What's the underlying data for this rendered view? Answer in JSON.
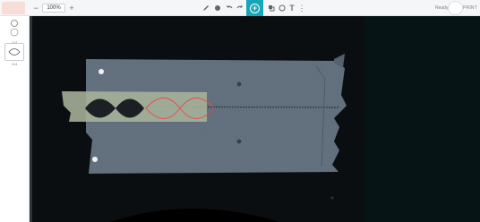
{
  "toolbar": {
    "zoom_out": "−",
    "zoom_value": "100%",
    "zoom_in": "+",
    "tools": [
      {
        "name": "draw-tool-icon",
        "glyph": "✎"
      },
      {
        "name": "fill-tool-icon",
        "glyph": "●"
      },
      {
        "name": "undo-icon",
        "glyph": "↶"
      },
      {
        "name": "redo-icon",
        "glyph": "↷"
      }
    ],
    "add_glyph": "+",
    "right_tools": [
      {
        "name": "layers-icon",
        "glyph": "◪"
      },
      {
        "name": "shape-icon",
        "glyph": "◌"
      },
      {
        "name": "text-tool-icon",
        "glyph": "T"
      },
      {
        "name": "more-icon",
        "glyph": "⋮"
      }
    ],
    "status": "Ready",
    "print_label": "PRINT"
  },
  "left_panel": {
    "items": [
      {
        "label": "2x3",
        "selected": false
      },
      {
        "label": "2x3",
        "selected": true
      }
    ]
  },
  "colors": {
    "accent": "#16a6b6",
    "design_stroke": "#e34b53",
    "canvas_bg": "#0b0e10"
  }
}
